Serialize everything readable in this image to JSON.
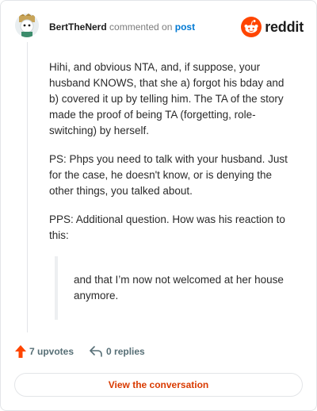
{
  "header": {
    "author": "BertTheNerd",
    "commented_text": "commented on",
    "post_link": "post",
    "brand": "reddit"
  },
  "comment": {
    "paragraphs": [
      "Hihi, and obvious NTA, and, if suppose, your husband KNOWS, that she a) forgot his bday and b) covered it up by telling him. The TA of the story made the proof of being TA (forgetting, role-switching) by herself.",
      "PS: Phps you need to talk with your husband. Just for the case, he doesn't know, or is denying the other things, you talked about.",
      "PPS: Additional question. How was his reaction to this:"
    ],
    "quote": "and that I’m now not welcomed at her house anymore."
  },
  "footer": {
    "upvotes": "7 upvotes",
    "replies": "0 replies",
    "cta": "View the conversation"
  },
  "colors": {
    "brand": "#ff4500",
    "link": "#0079d3",
    "cta": "#d93a00",
    "muted": "#576f76"
  }
}
